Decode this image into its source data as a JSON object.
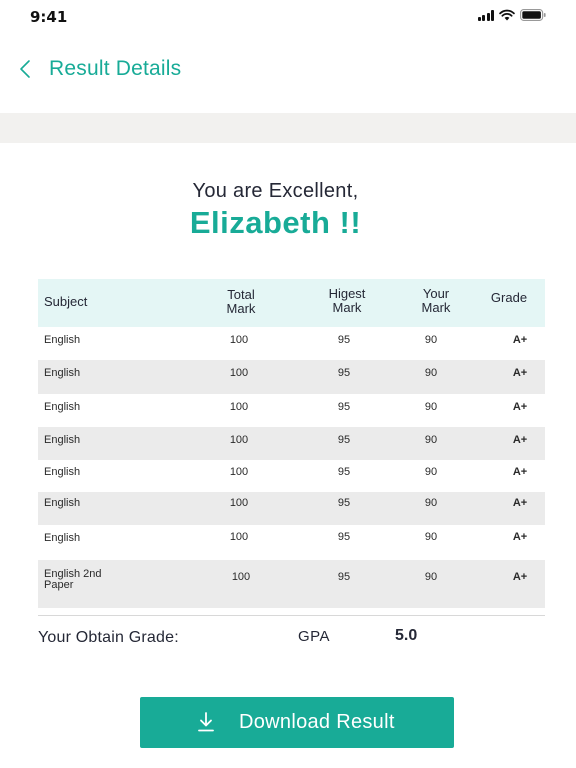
{
  "status_bar": {
    "time": "9:41"
  },
  "header": {
    "title": "Result Details",
    "back_icon": "chevron-left-icon"
  },
  "greeting": {
    "line1": "You are Excellent,",
    "name": "Elizabeth !!"
  },
  "table": {
    "columns": {
      "subject": "Subject",
      "total_mark_line1": "Total",
      "total_mark_line2": "Mark",
      "highest_mark_line1": "Higest",
      "highest_mark_line2": "Mark",
      "your_mark_line1": "Your",
      "your_mark_line2": "Mark",
      "grade": "Grade"
    },
    "rows": [
      {
        "subject": "English",
        "total": "100",
        "highest": "95",
        "your": "90",
        "grade": "A+"
      },
      {
        "subject": "English",
        "total": "100",
        "highest": "95",
        "your": "90",
        "grade": "A+"
      },
      {
        "subject": "English",
        "total": "100",
        "highest": "95",
        "your": "90",
        "grade": "A+"
      },
      {
        "subject": "English",
        "total": "100",
        "highest": "95",
        "your": "90",
        "grade": "A+"
      },
      {
        "subject": "English",
        "total": "100",
        "highest": "95",
        "your": "90",
        "grade": "A+"
      },
      {
        "subject": "English",
        "total": "100",
        "highest": "95",
        "your": "90",
        "grade": "A+"
      },
      {
        "subject": "English",
        "total": "100",
        "highest": "95",
        "your": "90",
        "grade": "A+"
      },
      {
        "subject": "English 2nd Paper",
        "total": "100",
        "highest": "95",
        "your": "90",
        "grade": "A+"
      }
    ]
  },
  "summary": {
    "label": "Your Obtain Grade:",
    "gpa_label": "GPA",
    "gpa_value": "5.0"
  },
  "download": {
    "label": "Download Result",
    "icon": "download-icon"
  },
  "colors": {
    "accent": "#18ab97",
    "header_row_bg": "#e4f6f5",
    "alt_row_bg": "#ebebeb",
    "band_bg": "#f2f1ef"
  }
}
